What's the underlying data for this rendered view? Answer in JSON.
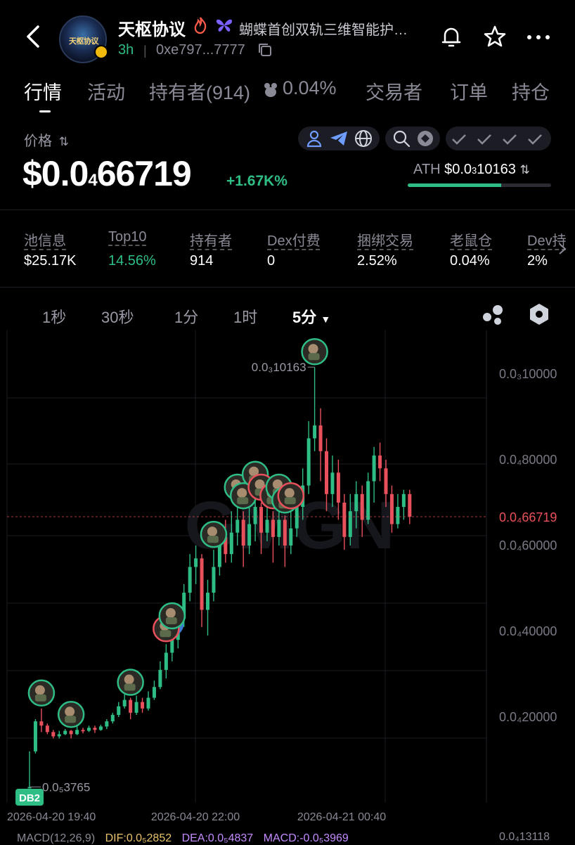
{
  "header": {
    "token_name": "天枢协议",
    "avatar_text": "天枢协议",
    "description": "蝴蝶首创双轨三维智能护…",
    "age": "3h",
    "address": "0xe797...7777"
  },
  "tabs": [
    "行情",
    "活动",
    "持有者(914)",
    "0.04%",
    "交易者",
    "订单",
    "持仓"
  ],
  "price": {
    "label": "价格",
    "main_prefix": "$0.0",
    "main_sub": "4",
    "main_rest": "66719",
    "change": "+1.67K%",
    "ath_label": "ATH",
    "ath_prefix": "$0.0",
    "ath_sub": "3",
    "ath_rest": "10163",
    "ath_progress": 0.65
  },
  "stats": [
    {
      "label": "池信息",
      "value": "$25.17K",
      "color": "white"
    },
    {
      "label": "Top10",
      "value": "14.56%",
      "color": "green"
    },
    {
      "label": "持有者",
      "value": "914",
      "color": "white"
    },
    {
      "label": "Dex付费",
      "value": "0",
      "color": "white"
    },
    {
      "label": "捆绑交易",
      "value": "2.52%",
      "color": "white"
    },
    {
      "label": "老鼠仓",
      "value": "0.04%",
      "color": "white"
    },
    {
      "label": "Dev持",
      "value": "2%",
      "color": "white"
    }
  ],
  "intervals": [
    "1秒",
    "30秒",
    "1分",
    "1时",
    "5分"
  ],
  "active_interval": "5分",
  "colors": {
    "up": "#2ebd85",
    "down": "#e8505b",
    "accent": "#3a7bd5",
    "bg": "#000000"
  },
  "chart_data": {
    "type": "candlestick",
    "y_axis_labels": [
      "0.0₃10000",
      "0.0₄80000",
      "0.0₄60000",
      "0.0₄40000",
      "0.0₄20000"
    ],
    "y_axis_values": [
      0.0001,
      8e-05,
      6e-05,
      4e-05,
      2e-05
    ],
    "x_axis_labels": [
      "2026-04-20 19:40",
      "2026-04-20 22:00",
      "2026-04-21 00:40"
    ],
    "current_price_label": "0.0₄66719",
    "current_price": 6.6719e-05,
    "high_label": "0.0₃10163",
    "low_label": "0.0₅3765",
    "marker_db2": "DB2",
    "marker_m": "M",
    "watermark": "GMGN",
    "candles": [
      [
        3.7e-06,
        3.7e-06,
        1.2e-05,
        3.7e-06
      ],
      [
        1.2e-05,
        1.9e-05,
        1.95e-05,
        1.15e-05
      ],
      [
        1.9e-05,
        1.8e-05,
        2.2e-05,
        1.65e-05
      ],
      [
        1.8e-05,
        1.65e-05,
        1.85e-05,
        1.6e-05
      ],
      [
        1.65e-05,
        1.55e-05,
        1.7e-05,
        1.5e-05
      ],
      [
        1.55e-05,
        1.6e-05,
        1.68e-05,
        1.5e-05
      ],
      [
        1.6e-05,
        1.68e-05,
        1.72e-05,
        1.58e-05
      ],
      [
        1.68e-05,
        1.6e-05,
        1.7e-05,
        1.5e-05
      ],
      [
        1.6e-05,
        1.7e-05,
        1.78e-05,
        1.58e-05
      ],
      [
        1.7e-05,
        1.68e-05,
        1.75e-05,
        1.62e-05
      ],
      [
        1.68e-05,
        1.75e-05,
        1.8e-05,
        1.65e-05
      ],
      [
        1.75e-05,
        1.7e-05,
        1.8e-05,
        1.63e-05
      ],
      [
        1.7e-05,
        1.78e-05,
        1.82e-05,
        1.68e-05
      ],
      [
        1.78e-05,
        1.9e-05,
        1.95e-05,
        1.72e-05
      ],
      [
        1.9e-05,
        2.05e-05,
        2.1e-05,
        1.85e-05
      ],
      [
        2.05e-05,
        2.25e-05,
        2.35e-05,
        2e-05
      ],
      [
        2.25e-05,
        2.4e-05,
        2.55e-05,
        2.2e-05
      ],
      [
        2.4e-05,
        2.1e-05,
        2.45e-05,
        1.95e-05
      ],
      [
        2.1e-05,
        2.35e-05,
        2.5e-05,
        2.05e-05
      ],
      [
        2.35e-05,
        2.2e-05,
        2.45e-05,
        2.1e-05
      ],
      [
        2.2e-05,
        2.45e-05,
        2.6e-05,
        2.15e-05
      ],
      [
        2.45e-05,
        2.7e-05,
        2.85e-05,
        2.4e-05
      ],
      [
        2.7e-05,
        3.1e-05,
        3.3e-05,
        2.65e-05
      ],
      [
        3.1e-05,
        3.5e-05,
        3.7e-05,
        2.9e-05
      ],
      [
        3.5e-05,
        3.8e-05,
        4e-05,
        3.3e-05
      ],
      [
        3.8e-05,
        4.3e-05,
        4.6e-05,
        3.6e-05
      ],
      [
        4.3e-05,
        4.9e-05,
        5.1e-05,
        4.1e-05
      ],
      [
        4.9e-05,
        5.5e-05,
        5.8e-05,
        4.7e-05
      ],
      [
        5.5e-05,
        5.7e-05,
        6e-05,
        5.1e-05
      ],
      [
        5.7e-05,
        4.5e-05,
        5.8e-05,
        4.1e-05
      ],
      [
        4.5e-05,
        4.9e-05,
        5.2e-05,
        3.9e-05
      ],
      [
        4.9e-05,
        5.5e-05,
        5.9e-05,
        4.7e-05
      ],
      [
        5.5e-05,
        6.2e-05,
        6.5e-05,
        5.3e-05
      ],
      [
        6.2e-05,
        5.8e-05,
        6.6e-05,
        5.6e-05
      ],
      [
        5.8e-05,
        6.3e-05,
        6.8e-05,
        5.6e-05
      ],
      [
        6.3e-05,
        6.6e-05,
        7e-05,
        6e-05
      ],
      [
        6.6e-05,
        6e-05,
        6.8e-05,
        5.5e-05
      ],
      [
        6e-05,
        6.5e-05,
        7e-05,
        5.8e-05
      ],
      [
        6.5e-05,
        6.9e-05,
        7.3e-05,
        6.1e-05
      ],
      [
        6.9e-05,
        6.3e-05,
        7e-05,
        5.8e-05
      ],
      [
        6.3e-05,
        6.6e-05,
        7.1e-05,
        6.1e-05
      ],
      [
        6.6e-05,
        6.2e-05,
        6.8e-05,
        5.6e-05
      ],
      [
        6.2e-05,
        6.6e-05,
        7e-05,
        6e-05
      ],
      [
        6.6e-05,
        6e-05,
        6.7e-05,
        5.5e-05
      ],
      [
        6e-05,
        6.4e-05,
        6.8e-05,
        5.8e-05
      ],
      [
        6.4e-05,
        6.9e-05,
        7.3e-05,
        6.2e-05
      ],
      [
        6.9e-05,
        7.4e-05,
        7.8e-05,
        6.6e-05
      ],
      [
        7.4e-05,
        8.5e-05,
        8.9e-05,
        7.2e-05
      ],
      [
        8.5e-05,
        8.8e-05,
        0.0001016,
        8.2e-05
      ],
      [
        8.8e-05,
        8.2e-05,
        9.2e-05,
        7.5e-05
      ],
      [
        8.2e-05,
        7.2e-05,
        8.5e-05,
        6.8e-05
      ],
      [
        7.2e-05,
        7.7e-05,
        8.1e-05,
        6.9e-05
      ],
      [
        7.7e-05,
        7e-05,
        8e-05,
        6.6e-05
      ],
      [
        7e-05,
        6.2e-05,
        7.2e-05,
        5.9e-05
      ],
      [
        6.2e-05,
        6.8e-05,
        7.2e-05,
        6e-05
      ],
      [
        6.8e-05,
        7.2e-05,
        7.5e-05,
        6.4e-05
      ],
      [
        7.2e-05,
        6.6e-05,
        7.4e-05,
        6.2e-05
      ],
      [
        6.6e-05,
        7.5e-05,
        7.7e-05,
        6.5e-05
      ],
      [
        7.5e-05,
        8.1e-05,
        8.3e-05,
        7e-05
      ],
      [
        8.1e-05,
        7.8e-05,
        8.4e-05,
        7.5e-05
      ],
      [
        7.8e-05,
        7.2e-05,
        8e-05,
        6.9e-05
      ],
      [
        7.2e-05,
        6.5e-05,
        7.4e-05,
        6.3e-05
      ],
      [
        6.5e-05,
        6.9e-05,
        7.2e-05,
        6.4e-05
      ],
      [
        6.9e-05,
        7.2e-05,
        7.3e-05,
        6.6e-05
      ],
      [
        7.2e-05,
        6.6719e-05,
        7.3e-05,
        6.5e-05
      ]
    ],
    "trade_markers": [
      {
        "i": 2,
        "side": "buy"
      },
      {
        "i": 7,
        "side": "buy"
      },
      {
        "i": 17,
        "side": "buy"
      },
      {
        "i": 23,
        "side": "sell"
      },
      {
        "i": 24,
        "side": "buy"
      },
      {
        "i": 31,
        "side": "buy"
      },
      {
        "i": 35,
        "side": "buy"
      },
      {
        "i": 36,
        "side": "buy"
      },
      {
        "i": 38,
        "side": "buy"
      },
      {
        "i": 39,
        "side": "sell"
      },
      {
        "i": 41,
        "side": "sell"
      },
      {
        "i": 42,
        "side": "buy"
      },
      {
        "i": 43,
        "side": "buy"
      },
      {
        "i": 44,
        "side": "sell"
      },
      {
        "i": 48,
        "side": "buy"
      },
      {
        "i": 48,
        "side": "sell"
      }
    ]
  },
  "indicators": {
    "macd": "MACD(12,26,9)",
    "dif": "DIF:0.0₅2852",
    "dea": "DEA:0.0₅4837",
    "macd_value": "MACD:-0.0₅3969",
    "right_value": "0.0₄13118"
  }
}
